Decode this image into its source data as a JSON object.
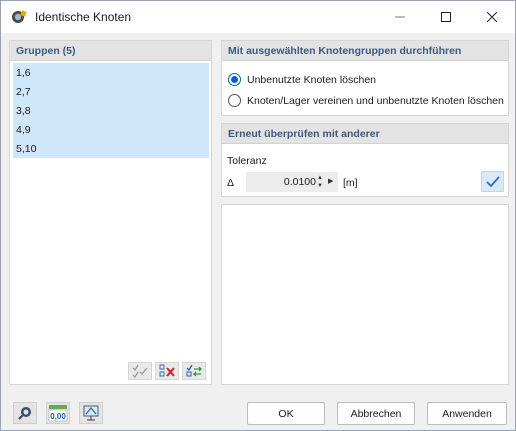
{
  "window": {
    "title": "Identische Knoten"
  },
  "groups": {
    "header": "Gruppen (5)",
    "items": [
      "1,6",
      "2,7",
      "3,8",
      "4,9",
      "5,10"
    ]
  },
  "options": {
    "header": "Mit ausgewählten Knotengruppen durchführen",
    "radio1": "Unbenutzte Knoten löschen",
    "radio2": "Knoten/Lager vereinen und unbenutzte Knoten löschen",
    "selected": "radio1"
  },
  "recheck": {
    "header": "Erneut überprüfen mit anderer",
    "tolerance_label": "Toleranz",
    "delta_symbol": "Δ",
    "value": "0.0100",
    "unit": "[m]"
  },
  "buttons": {
    "ok": "OK",
    "cancel": "Abbrechen",
    "apply": "Anwenden"
  },
  "bottom_icons": {
    "units_label": "0,00"
  },
  "colors": {
    "accent": "#0a5fc8",
    "selection": "#cfe6fb",
    "header_text": "#3c5a80"
  }
}
